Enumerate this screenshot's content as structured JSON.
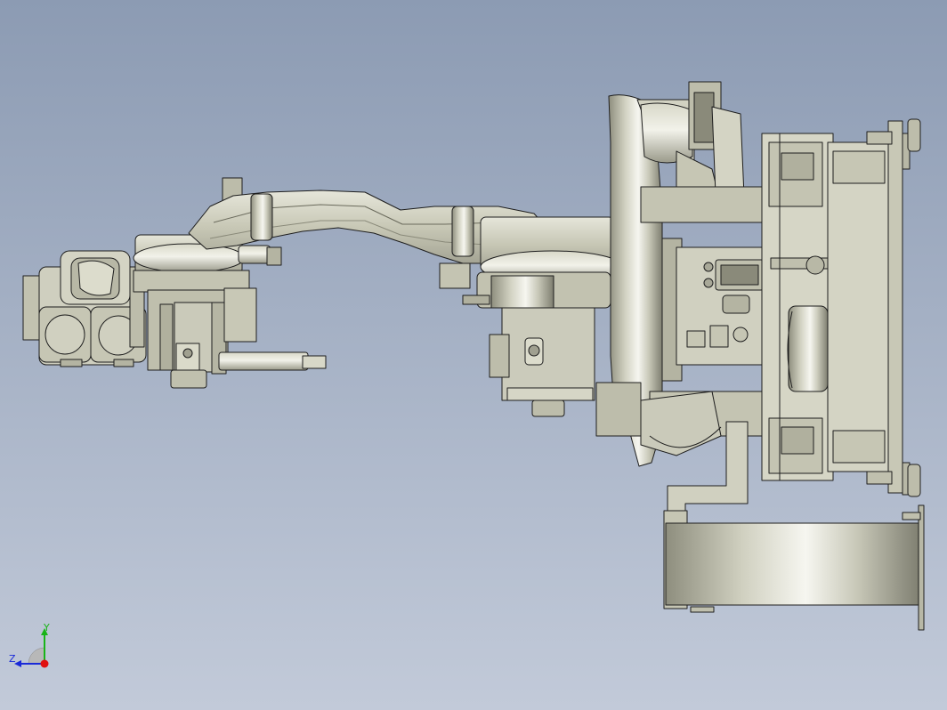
{
  "viewport": {
    "background_top": "#8c9bb3",
    "background_bottom": "#c2cad9"
  },
  "model": {
    "part_fill": "#c9c9b8",
    "part_fill_light": "#e4e4d8",
    "part_fill_dark": "#8f8f80",
    "edge_color": "#1e1e1e"
  },
  "triad": {
    "y_label": "Y",
    "z_label": "Z",
    "y_color": "#18b418",
    "z_color": "#1a2ad8",
    "x_color": "#e01010"
  }
}
